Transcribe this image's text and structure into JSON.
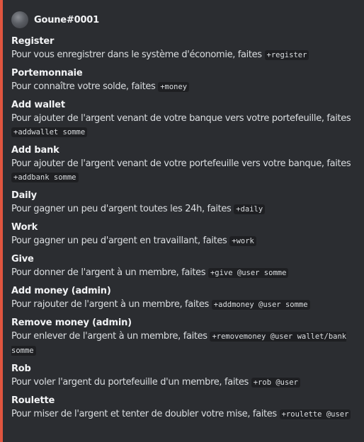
{
  "author": {
    "name": "Goune#0001",
    "avatar_icon": "user-avatar"
  },
  "accent_color": "#e0553f",
  "fields": [
    {
      "name": "Register",
      "text": "Pour vous enregistrer dans le système d'économie, faites",
      "command": "+register"
    },
    {
      "name": "Portemonnaie",
      "text": "Pour connaître votre solde, faites",
      "command": "+money"
    },
    {
      "name": "Add wallet",
      "text": "Pour ajouter de l'argent venant de votre banque vers votre portefeuille, faites",
      "command": "+addwallet somme"
    },
    {
      "name": "Add bank",
      "text": "Pour ajouter de l'argent venant de votre portefeuille vers votre banque, faites",
      "command": "+addbank somme"
    },
    {
      "name": "Daily",
      "text": "Pour gagner un peu d'argent toutes les 24h, faites",
      "command": "+daily"
    },
    {
      "name": "Work",
      "text": "Pour gagner un peu d'argent en travaillant, faites",
      "command": "+work"
    },
    {
      "name": "Give",
      "text": "Pour donner de l'argent à un membre, faites",
      "command": "+give @user somme"
    },
    {
      "name": "Add money (admin)",
      "text": "Pour rajouter de l'argent à un membre, faites",
      "command": "+addmoney @user somme"
    },
    {
      "name": "Remove money (admin)",
      "text": "Pour enlever de l'argent à un membre, faites",
      "command": "+removemoney @user wallet/bank somme"
    },
    {
      "name": "Rob",
      "text": "Pour voler l'argent du portefeuille d'un membre, faites",
      "command": "+rob @user"
    },
    {
      "name": "Roulette",
      "text": "Pour miser de l'argent et tenter de doubler votre mise, faites",
      "command": "+roulette @user"
    }
  ]
}
